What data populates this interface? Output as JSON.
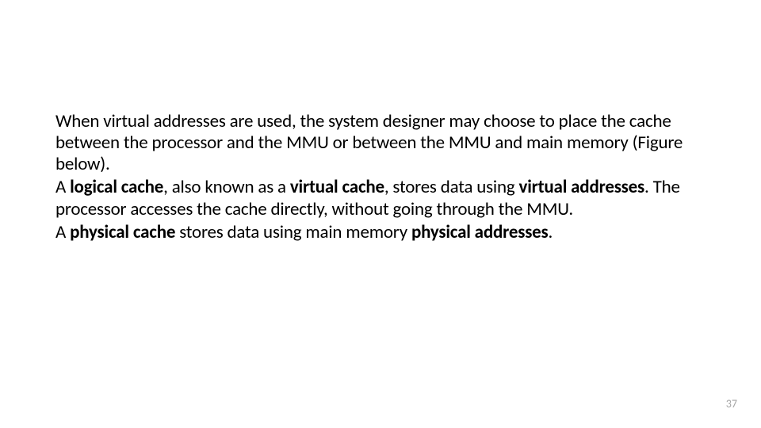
{
  "slide": {
    "p1_a": "When virtual addresses are used, the system designer may choose to place the cache between the processor and the MMU or between the MMU and main memory (Figure below).",
    "p2_a": "A ",
    "p2_b": "logical cache",
    "p2_c": ", also known as a ",
    "p2_d": "virtual cache",
    "p2_e": ", stores data using ",
    "p2_f": "virtual addresses",
    "p2_g": ". The processor accesses the cache directly, without going through the MMU.",
    "p3_a": "A ",
    "p3_b": "physical cache",
    "p3_c": " stores data using main memory ",
    "p3_d": "physical addresses",
    "p3_e": "."
  },
  "page_number": "37"
}
